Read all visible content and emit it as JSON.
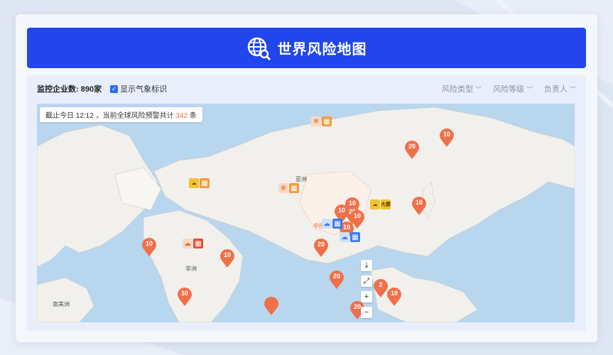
{
  "header": {
    "title": "世界风险地图"
  },
  "toolbar": {
    "monitor_count": "监控企业数: 890家",
    "show_weather_label": "显示气象标识",
    "filters": [
      "风险类型",
      "风险等级",
      "负责人"
    ]
  },
  "notice": {
    "prefix": "截止今日 12:12 ，当前全球风险预警共计 ",
    "count": "342",
    "suffix": " 条"
  },
  "map": {
    "labels": [
      "亚洲",
      "非洲",
      "南美洲",
      "中国"
    ],
    "pins": [
      "10",
      "20",
      "10",
      "10",
      "10",
      "20",
      "10",
      "10",
      "10",
      "10",
      "20",
      "10",
      "20",
      "2",
      "10",
      "20"
    ],
    "weather_badges": {
      "y": "大雾"
    },
    "controls": [
      "⤓",
      "⤢",
      "+",
      "−"
    ]
  },
  "colors": {
    "primary": "#2146ee",
    "pin": "#f0704a",
    "ocean": "#b9d6ef",
    "land": "#f1f0ec"
  }
}
